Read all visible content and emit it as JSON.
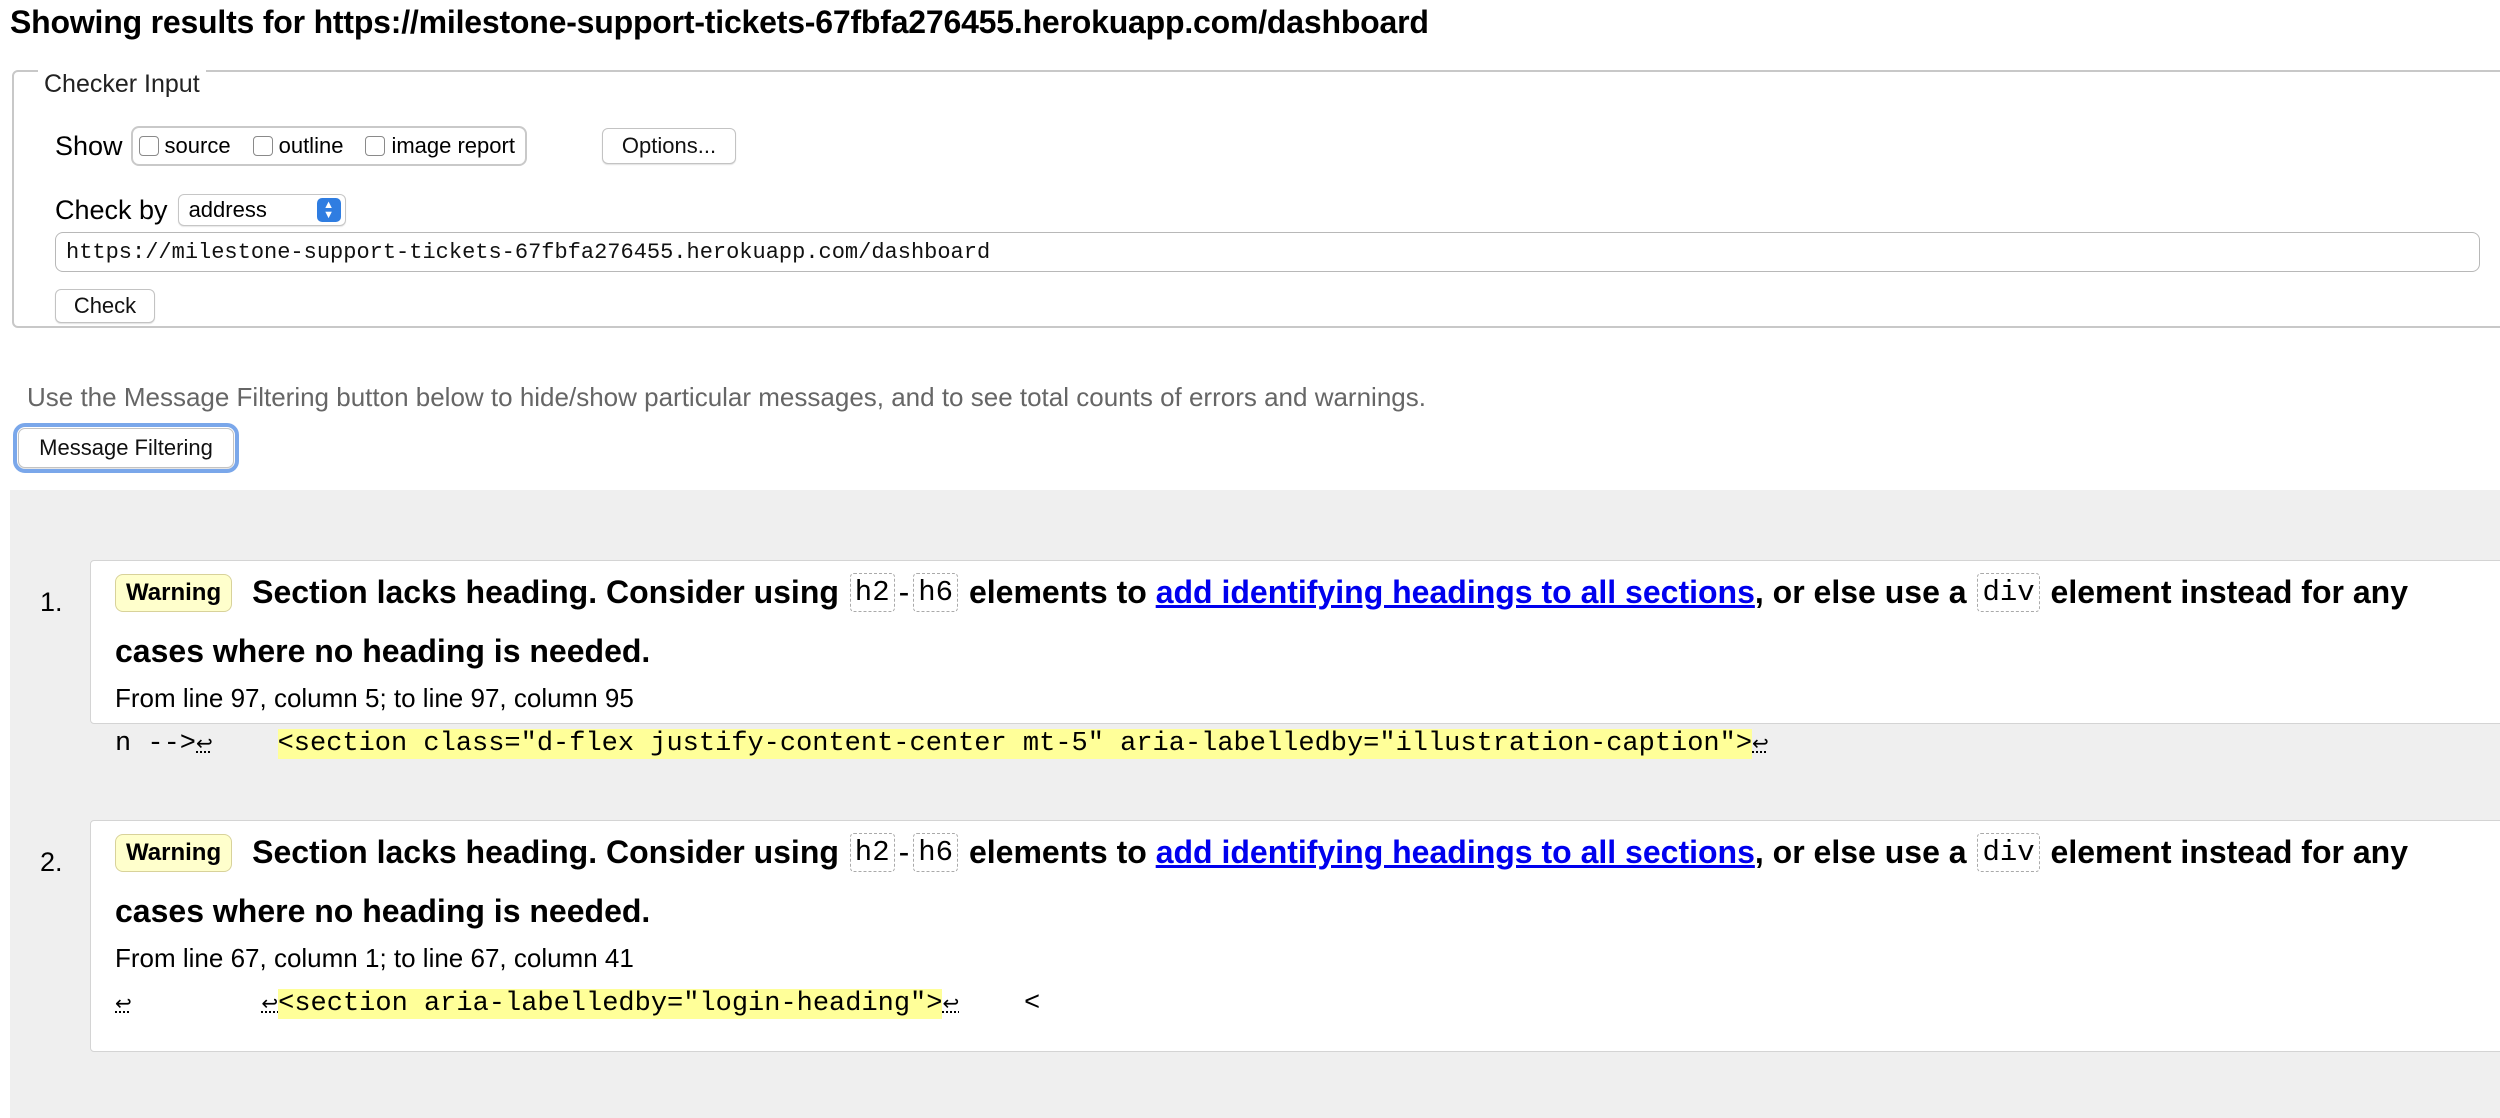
{
  "header": {
    "title": "Showing results for https://milestone-support-tickets-67fbfa276455.herokuapp.com/dashboard"
  },
  "checker": {
    "legend": "Checker Input",
    "show_label": "Show",
    "checkboxes": [
      {
        "label": "source",
        "checked": false
      },
      {
        "label": "outline",
        "checked": false
      },
      {
        "label": "image report",
        "checked": false
      }
    ],
    "options_label": "Options...",
    "checkby_label": "Check by",
    "checkby_value": "address",
    "url_value": "https://milestone-support-tickets-67fbfa276455.herokuapp.com/dashboard",
    "check_label": "Check"
  },
  "hint": "Use the Message Filtering button below to hide/show particular messages, and to see total counts of errors and warnings.",
  "filter_label": "Message Filtering",
  "messages": [
    {
      "num": "1.",
      "type": "Warning",
      "text_a": "Section lacks heading. Consider using",
      "code1": "h2",
      "dash": "-",
      "code2": "h6",
      "text_b": "elements to",
      "link": "add identifying headings to all sections",
      "text_c": ", or else use a",
      "code3": "div",
      "text_d": "element instead for any",
      "text_e": "cases where no heading is needed.",
      "location": "From line 97, column 5; to line 97, column 95",
      "extract_before": "n -->",
      "extract_mid": "    ",
      "extract_highlight": "<section class=\"d-flex justify-content-center mt-5\" aria-labelledby=\"illustration-caption\">",
      "extract_after": ""
    },
    {
      "num": "2.",
      "type": "Warning",
      "text_a": "Section lacks heading. Consider using",
      "code1": "h2",
      "dash": "-",
      "code2": "h6",
      "text_b": "elements to",
      "link": "add identifying headings to all sections",
      "text_c": ", or else use a",
      "code3": "div",
      "text_d": "element instead for any",
      "text_e": "cases where no heading is needed.",
      "location": "From line 67, column 1; to line 67, column 41",
      "extract_before": "",
      "extract_mid": "        ",
      "extract_highlight": "<section aria-labelledby=\"login-heading\">",
      "extract_after": "    <"
    }
  ],
  "colors": {
    "warning_badge_bg": "#ffffcc",
    "highlight": "#ffff99",
    "link": "#0000ee",
    "results_bg": "#efefef",
    "focus_ring": "#7aa7ea",
    "select_accent": "#2f7de1"
  },
  "icons": {
    "newline": "newline-glyph-icon",
    "select": "select-arrows-icon"
  }
}
